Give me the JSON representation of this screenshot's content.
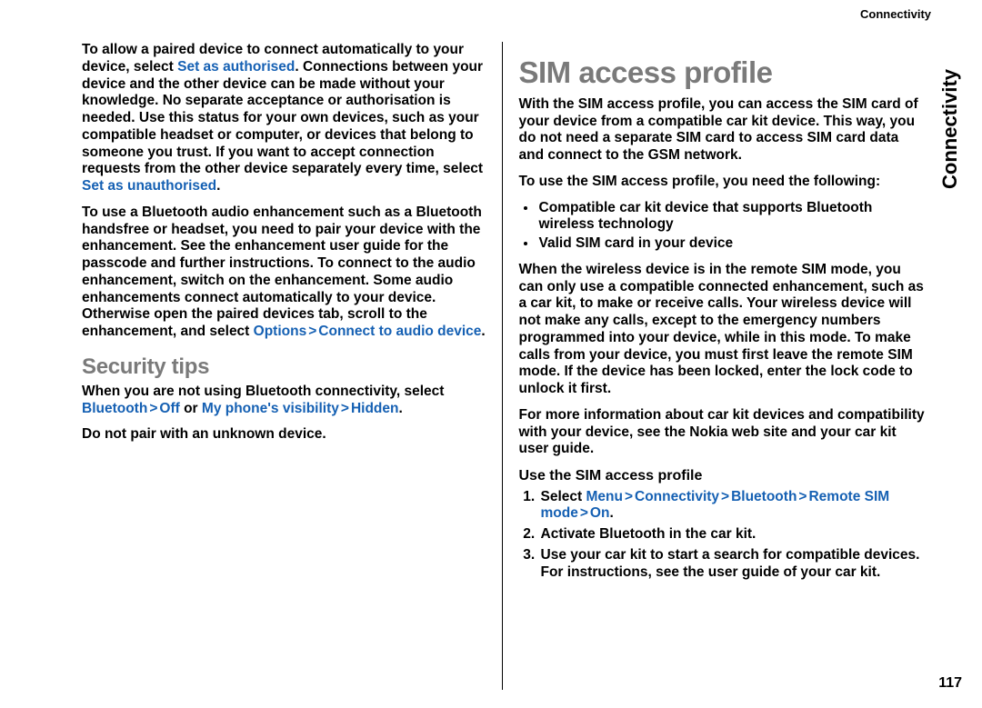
{
  "header": {
    "section": "Connectivity"
  },
  "sideTab": "Connectivity",
  "pageNumber": "117",
  "left": {
    "para1_a": "To allow a paired device to connect automatically to your device, select ",
    "para1_kw1": "Set as authorised",
    "para1_b": ". Connections between your device and the other device can be made without your knowledge. No separate acceptance or authorisation is needed. Use this status for your own devices, such as your compatible headset or computer, or devices that belong to someone you trust. If you want to accept connection requests from the other device separately every time, select ",
    "para1_kw2": "Set as unauthorised",
    "para1_c": ".",
    "para2_a": "To use a Bluetooth audio enhancement such as a Bluetooth handsfree or headset, you need to pair your device with the enhancement. See the enhancement user guide for the passcode and further instructions. To connect to the audio enhancement, switch on the enhancement. Some audio enhancements connect automatically to your device. Otherwise open the paired devices tab, scroll to the enhancement, and select ",
    "para2_kw1": "Options",
    "para2_kw2": "Connect to audio device",
    "para2_b": ".",
    "h2": "Security tips",
    "para3_a": "When you are not using Bluetooth connectivity, select ",
    "para3_kw1": "Bluetooth",
    "para3_kw2": "Off",
    "para3_mid": " or ",
    "para3_kw3": "My phone's visibility",
    "para3_kw4": "Hidden",
    "para3_b": ".",
    "para4": "Do not pair with an unknown device."
  },
  "right": {
    "h1": "SIM access profile",
    "para1": "With the SIM access profile, you can access the SIM card of your device from a compatible car kit device. This way, you do not need a separate SIM card to access SIM card data and connect to the GSM network.",
    "para2": "To use the SIM access profile, you need the following:",
    "bul1": "Compatible car kit device that supports Bluetooth wireless technology",
    "bul2": "Valid SIM card in your device",
    "para3": "When the wireless device is in the remote SIM mode, you can only use a compatible connected enhancement, such as a car kit, to make or receive calls. Your wireless device will not make any calls, except to the emergency numbers programmed into your device, while in this mode. To make calls from your device, you must first leave the remote SIM mode. If the device has been locked, enter the lock code to unlock it first.",
    "para4": "For more information about car kit devices and compatibility with your device, see the Nokia web site and your car kit user guide.",
    "h3": "Use the SIM access profile",
    "step1_a": "Select ",
    "step1_kw1": "Menu",
    "step1_kw2": "Connectivity",
    "step1_kw3": "Bluetooth",
    "step1_kw4": "Remote SIM mode",
    "step1_kw5": "On",
    "step1_b": ".",
    "step2": "Activate Bluetooth in the car kit.",
    "step3": "Use your car kit to start a search for compatible devices. For instructions, see the user guide of your car kit."
  },
  "gt": ">"
}
